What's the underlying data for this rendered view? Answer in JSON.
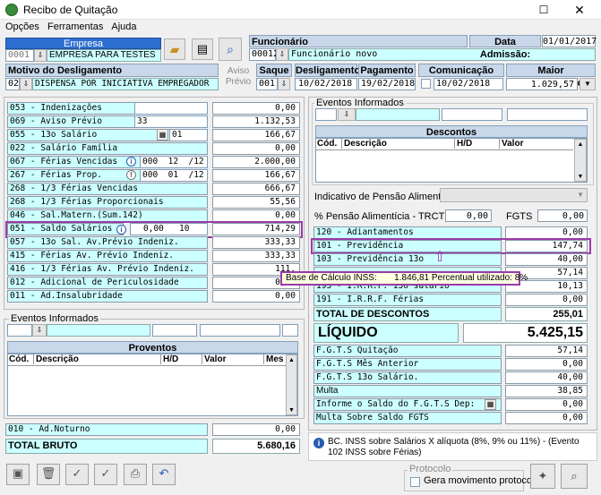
{
  "window": {
    "title": "Recibo de Quitação"
  },
  "menu": [
    "Opções",
    "Ferramentas",
    "Ajuda"
  ],
  "empresa": {
    "label": "Empresa",
    "code": "0001",
    "name": "EMPRESA PARA TESTES"
  },
  "funcionario": {
    "label": "Funcionário",
    "code": "00012",
    "name": "Funcionário novo"
  },
  "admissao": {
    "label": "Data Admissão:",
    "value": "01/01/2017"
  },
  "motivo": {
    "label": "Motivo do Desligamento",
    "code": "02",
    "text": "DISPENSA POR INICIATIVA EMPREGADOR"
  },
  "aviso": {
    "line1": "Aviso",
    "line2": "Prévio"
  },
  "saque": {
    "label": "Saque",
    "value": "001"
  },
  "desligamento": {
    "label": "Desligamento",
    "value": "10/02/2018"
  },
  "pagamento": {
    "label": "Pagamento",
    "value": "19/02/2018"
  },
  "comunicacao": {
    "label": "Comunicação Aviso",
    "value": "10/02/2018"
  },
  "maior": {
    "label": "Maior Remuneração",
    "value": "1.029,57"
  },
  "left_rows": [
    {
      "label": "053 - Indenizações",
      "ref": "",
      "value": "0,00"
    },
    {
      "label": "069 - Aviso Prévio",
      "ref": "33",
      "value": "1.132,53"
    },
    {
      "label": "055 - 13o Salário",
      "ref": "01",
      "value": "166,67"
    },
    {
      "label": "022 - Salário Família",
      "ref": "",
      "value": "0,00"
    },
    {
      "label": "067 - Férias Vencidas",
      "ref": "000  12  /12",
      "value": "2.000,00"
    },
    {
      "label": "267 - Férias Prop.",
      "ref": "000  01  /12",
      "value": "166,67"
    },
    {
      "label": "268 - 1/3 Férias Vencidas",
      "ref": "",
      "value": "666,67"
    },
    {
      "label": "268 - 1/3 Férias Proporcionais",
      "ref": "",
      "value": "55,56"
    },
    {
      "label": "046 - Sal.Matern.(Sum.142)",
      "ref": "",
      "value": "0,00"
    },
    {
      "label": "051 - Saldo Salários",
      "ref": "0,00   10",
      "value": "714,29"
    },
    {
      "label": "057 - 13o Sal. Av.Prévio Indeniz.",
      "ref": "",
      "value": "333,33"
    },
    {
      "label": "415 - Férias  Av. Prévio Indeniz.",
      "ref": "",
      "value": "333,33"
    },
    {
      "label": "416 - 1/3 Férias Av. Prévio Indeniz.",
      "ref": "",
      "value": "111,"
    },
    {
      "label": "012 - Adicional de Periculosidade",
      "ref": "",
      "value": "0,00"
    },
    {
      "label": "011 - Ad.Insalubridade",
      "ref": "",
      "value": "0,00"
    }
  ],
  "eventos_left": {
    "label": "Eventos Informados"
  },
  "proventos": {
    "title": "Proventos",
    "cols": [
      "Cód.",
      "Descrição",
      "H/D",
      "Valor",
      "Mes"
    ]
  },
  "adnoturno": {
    "label": "010 - Ad.Noturno",
    "value": "0,00"
  },
  "total_bruto": {
    "label": "TOTAL BRUTO",
    "value": "5.680,16"
  },
  "eventos_right": {
    "label": "Eventos Informados"
  },
  "descontos": {
    "title": "Descontos",
    "cols": [
      "Cód.",
      "Descrição",
      "H/D",
      "Valor"
    ]
  },
  "pensao": {
    "indicativo": "Indicativo de Pensão Alimentícia",
    "percent_label": "% Pensão Alimentícia - TRCT",
    "percent_value": "0,00",
    "fgts_label": "FGTS",
    "fgts_value": "0,00"
  },
  "right_rows": [
    {
      "label": "120 - Adiantamentos",
      "value": "0,00"
    },
    {
      "label": "101 - Previdência",
      "value": "147,74"
    },
    {
      "label": "103 - Previdência 13o",
      "value": "40,00"
    },
    {
      "label": "",
      "value": "57,14"
    },
    {
      "label": "193 - I.R.R.F. 13o salário",
      "value": "10,13"
    },
    {
      "label": "191 - I.R.R.F. Férias",
      "value": "0,00"
    }
  ],
  "tooltip": {
    "text": "Base de Cálculo INSS:       1.846,81 Percentual utilizado: 8%"
  },
  "total_descontos": {
    "label": "TOTAL DE DESCONTOS",
    "value": "255,01"
  },
  "liquido": {
    "label": "LÍQUIDO",
    "value": "5.425,15"
  },
  "fgts_rows": [
    {
      "label": "F.G.T.S Quitação",
      "value": "57,14"
    },
    {
      "label": "F.G.T.S  Mês Anterior",
      "value": "0,00"
    },
    {
      "label": "F.G.T.S  13o Salário.",
      "value": "40,00"
    },
    {
      "label": "Multa",
      "value": "38,85"
    },
    {
      "label": "Informe o Saldo do F.G.T.S Dep:",
      "value": "0,00"
    },
    {
      "label": "Multa Sobre Saldo FGTS",
      "value": "0,00"
    }
  ],
  "info": {
    "text": "BC. INSS sobre Salários X alíquota (8%, 9% ou 11%) - (Evento 102 INSS sobre Férias)"
  },
  "protocolo": {
    "label": "Protocolo",
    "checkbox": "Gera movimento protocolo"
  }
}
